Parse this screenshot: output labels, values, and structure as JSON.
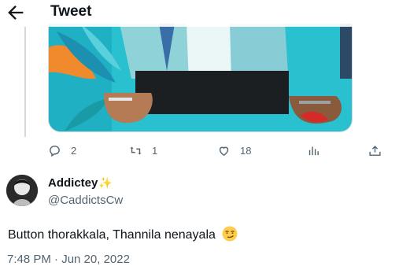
{
  "header": {
    "title": "Tweet"
  },
  "actions": {
    "replies": "2",
    "retweets": "1",
    "likes": "18"
  },
  "author": {
    "name": "Addictey",
    "handle": "@CaddictsCw",
    "name_emoji": "✨"
  },
  "tweet": {
    "text": "Button thorakkala, Thannila nenayala",
    "emoji": "smirking-face",
    "timestamp": "7:48 PM · Jun 20, 2022"
  },
  "icons": [
    "back-arrow-icon",
    "reply-icon",
    "retweet-icon",
    "like-icon",
    "analytics-icon",
    "share-icon"
  ],
  "colors": {
    "secondary_text": "#536471",
    "primary_text": "#0f1419",
    "divider": "#cfd9de"
  }
}
